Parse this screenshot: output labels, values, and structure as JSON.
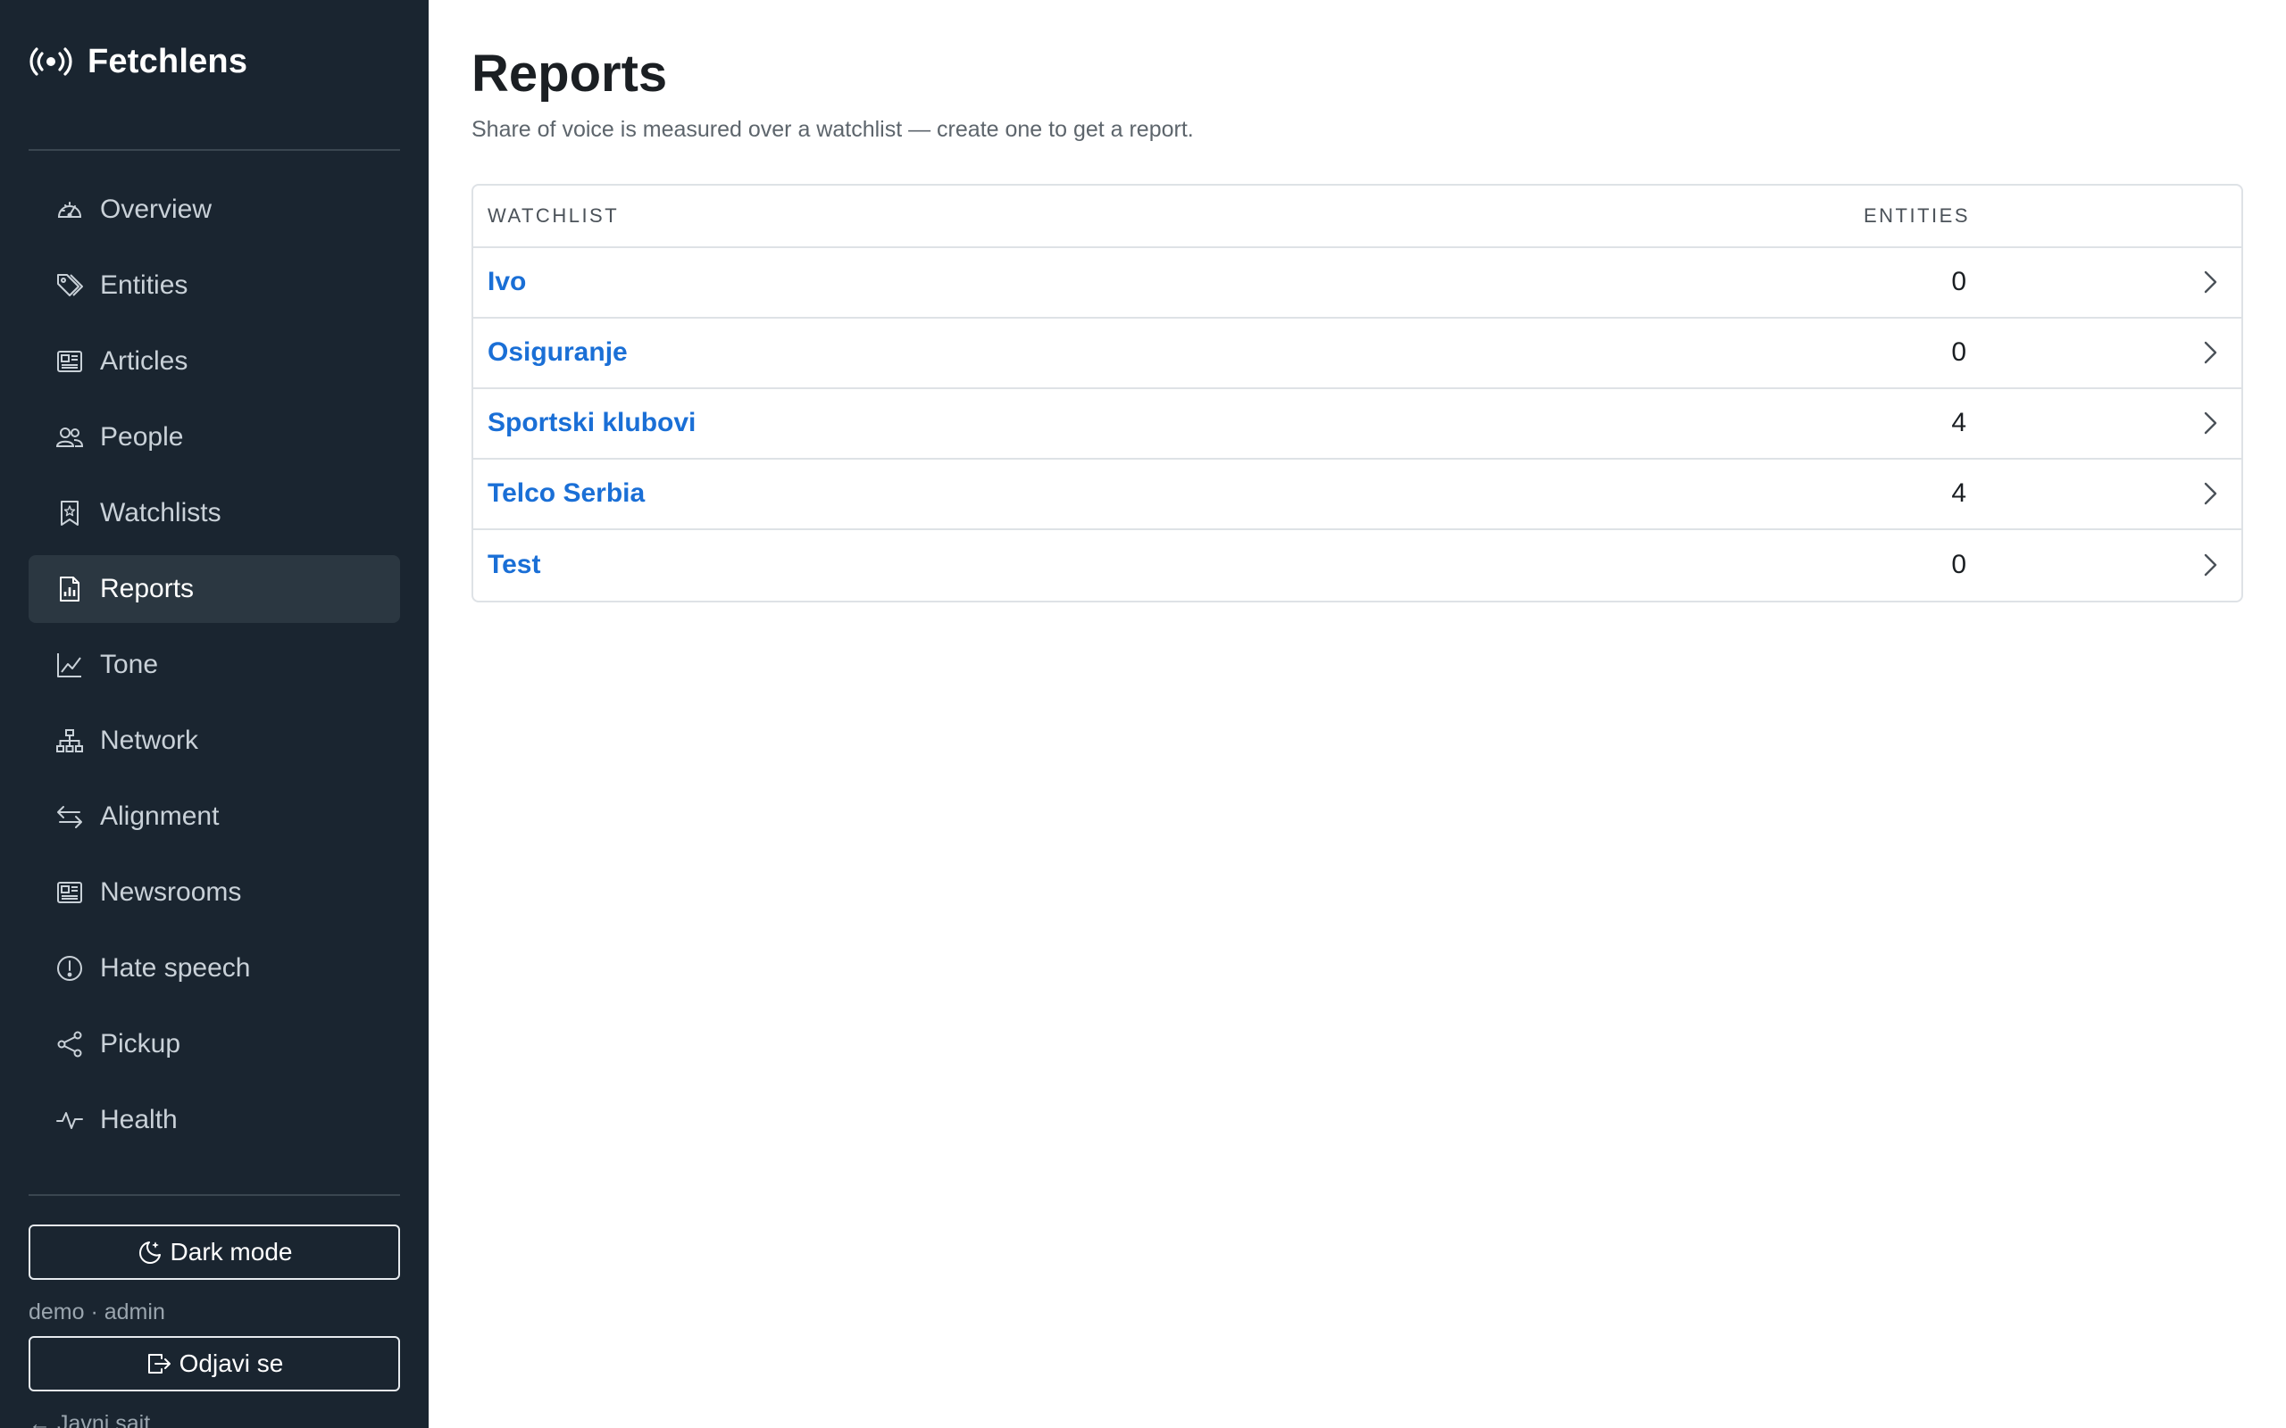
{
  "app": {
    "name": "Fetchlens"
  },
  "sidebar": {
    "items": [
      {
        "label": "Overview",
        "icon": "speedometer-icon",
        "active": false
      },
      {
        "label": "Entities",
        "icon": "tags-icon",
        "active": false
      },
      {
        "label": "Articles",
        "icon": "newspaper-icon",
        "active": false
      },
      {
        "label": "People",
        "icon": "people-icon",
        "active": false
      },
      {
        "label": "Watchlists",
        "icon": "bookmark-star-icon",
        "active": false
      },
      {
        "label": "Reports",
        "icon": "file-bar-chart-icon",
        "active": true
      },
      {
        "label": "Tone",
        "icon": "line-graph-icon",
        "active": false
      },
      {
        "label": "Network",
        "icon": "diagram-icon",
        "active": false
      },
      {
        "label": "Alignment",
        "icon": "arrow-left-right-icon",
        "active": false
      },
      {
        "label": "Newsrooms",
        "icon": "newspaper-icon",
        "active": false
      },
      {
        "label": "Hate speech",
        "icon": "exclamation-circle-icon",
        "active": false
      },
      {
        "label": "Pickup",
        "icon": "share-icon",
        "active": false
      },
      {
        "label": "Health",
        "icon": "activity-icon",
        "active": false
      }
    ],
    "dark_mode_label": "Dark mode",
    "user_line": "demo · admin",
    "logout_label": "Odjavi se",
    "public_link": "← Javni sajt"
  },
  "main": {
    "title": "Reports",
    "subtitle": "Share of voice is measured over a watchlist — create one to get a report.",
    "table": {
      "headers": {
        "watchlist": "WATCHLIST",
        "entities": "ENTITIES"
      },
      "rows": [
        {
          "name": "Ivo",
          "entities": "0"
        },
        {
          "name": "Osiguranje",
          "entities": "0"
        },
        {
          "name": "Sportski klubovi",
          "entities": "4"
        },
        {
          "name": "Telco Serbia",
          "entities": "4"
        },
        {
          "name": "Test",
          "entities": "0"
        }
      ]
    }
  },
  "colors": {
    "sidebar_bg": "#1a2530",
    "sidebar_active_bg": "#2b3741",
    "link_blue": "#1a6fd6"
  }
}
